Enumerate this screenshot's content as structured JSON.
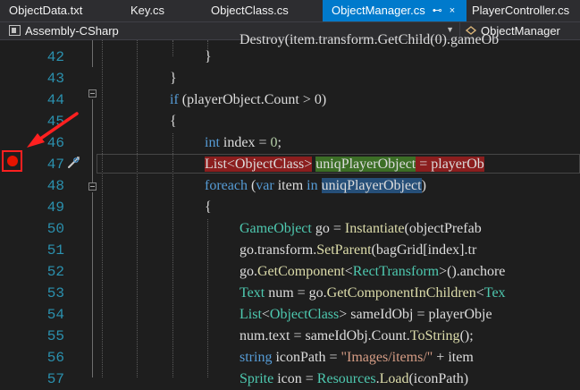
{
  "tabs": [
    {
      "label": "ObjectData.txt",
      "active": false
    },
    {
      "label": "Key.cs",
      "active": false
    },
    {
      "label": "ObjectClass.cs",
      "active": false
    },
    {
      "label": "ObjectManager.cs",
      "active": true
    },
    {
      "label": "PlayerController.cs",
      "active": false
    }
  ],
  "active_tab_pin": "⊷",
  "active_tab_close": "×",
  "navbar": {
    "project": "Assembly-CSharp",
    "class": "ObjectManager"
  },
  "editor": {
    "top_partial_line": "Destroy(item.transform.GetChild(0).gameOb",
    "line_numbers": [
      "42",
      "43",
      "44",
      "45",
      "46",
      "47",
      "48",
      "49",
      "50",
      "51",
      "52",
      "53",
      "54",
      "55",
      "56",
      "57"
    ],
    "lines": {
      "l42": "}",
      "l43": "}",
      "l44_if": "if",
      "l44_rest": " (playerObject.Count > 0)",
      "l45": "{",
      "l46_kw": "int",
      "l46_rest": " index = ",
      "l46_num": "0",
      "l46_end": ";",
      "l47_a": "List<ObjectClass>",
      "l47_b": " ",
      "l47_c": "uniqPlayerObject",
      "l47_d": " = playerOb",
      "l48_kw": "foreach",
      "l48_p": " (",
      "l48_var": "var",
      "l48_item": " item ",
      "l48_in": "in",
      "l48_sp": " ",
      "l48_obj": "uniqPlayerObject",
      "l48_end": ")",
      "l49": "{",
      "l50_ty": "GameObject",
      "l50_a": " go = ",
      "l50_fn": "Instantiate",
      "l50_b": "(objectPrefab",
      "l51_a": "go.transform.",
      "l51_fn": "SetParent",
      "l51_b": "(bagGrid[index].tr",
      "l52_a": "go.",
      "l52_fn": "GetComponent",
      "l52_lt": "<",
      "l52_ty": "RectTransform",
      "l52_b": ">().anchore",
      "l53_ty": "Text",
      "l53_a": " num = go.",
      "l53_fn": "GetComponentInChildren",
      "l53_lt": "<",
      "l53_ty2": "Tex",
      "l54_ty": "List",
      "l54_lt": "<",
      "l54_ty2": "ObjectClass",
      "l54_a": "> sameIdObj = playerObje",
      "l55_a": "num.text = sameIdObj.Count.",
      "l55_fn": "ToString",
      "l55_b": "();",
      "l56_kw": "string",
      "l56_a": " iconPath = ",
      "l56_st": "\"Images/items/\"",
      "l56_b": " + item",
      "l57_ty": "Sprite",
      "l57_a": " icon = ",
      "l57_ty2": "Resources",
      "l57_b": ".",
      "l57_fn": "Load",
      "l57_c": "(iconPath)"
    }
  },
  "colors": {
    "accent_tab": "#007acc",
    "breakpoint": "#e51400",
    "annotation": "#ff2020"
  }
}
